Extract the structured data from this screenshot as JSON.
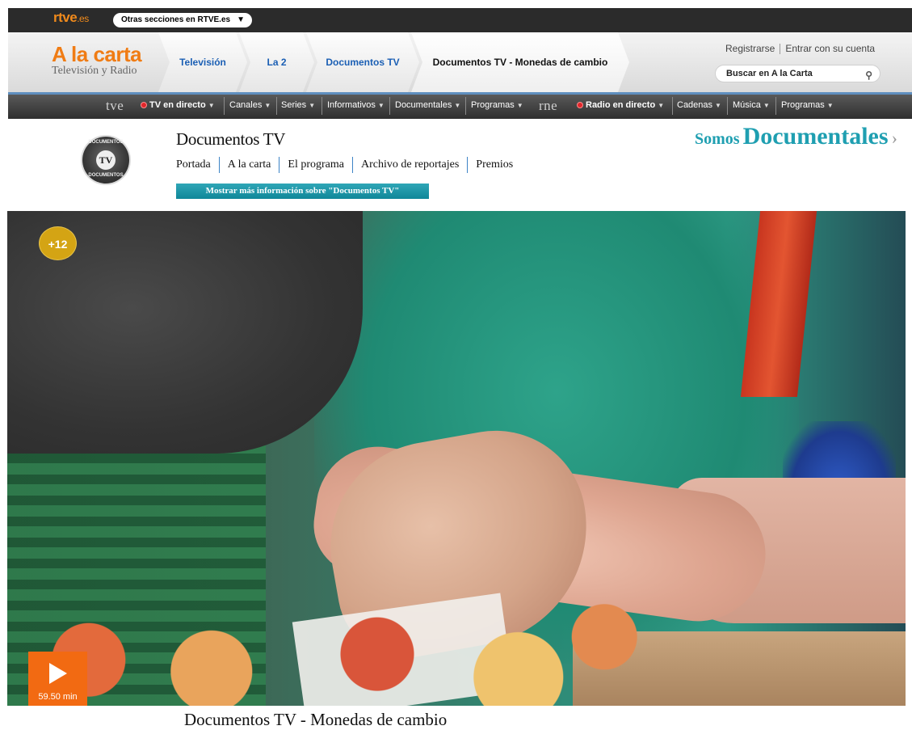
{
  "topbar": {
    "logo_main": "rtve",
    "logo_suffix": ".es",
    "otras_secciones": "Otras secciones en RTVE.es",
    "otras_arrow": "▼"
  },
  "header": {
    "title": "A la carta",
    "subtitle": "Televisión y Radio",
    "breadcrumbs": [
      "Televisión",
      "La 2",
      "Documentos TV",
      "Documentos TV - Monedas de cambio"
    ],
    "register": "Registrarse",
    "login": "Entrar con su cuenta",
    "search_label": "Buscar en A la Carta"
  },
  "nav": {
    "tv_brand": "tve",
    "tv_live": "TV en directo",
    "tv_items": [
      "Canales",
      "Series",
      "Informativos",
      "Documentales",
      "Programas"
    ],
    "radio_brand": "rne",
    "radio_live": "Radio en directo",
    "radio_items": [
      "Cadenas",
      "Música",
      "Programas"
    ]
  },
  "program": {
    "logo_ring_top": "DOCUMENTOS",
    "logo_center": "TV",
    "logo_ring_bottom": "DOCUMENTOS",
    "title": "Documentos TV",
    "links": [
      "Portada",
      "A la carta",
      "El programa",
      "Archivo de reportajes",
      "Premios"
    ],
    "more_info": "Mostrar más información sobre \"Documentos TV\"",
    "promo_small": "Somos",
    "promo_big": "Documentales",
    "promo_chevron": "›"
  },
  "video": {
    "age_rating": "+12",
    "duration": "59.50 min",
    "title": "Documentos TV - Monedas de cambio"
  },
  "colors": {
    "accent_orange": "#f26a12",
    "link_blue": "#1b5fb4",
    "teal": "#1f9fb1",
    "badge_gold": "#d4a414"
  }
}
